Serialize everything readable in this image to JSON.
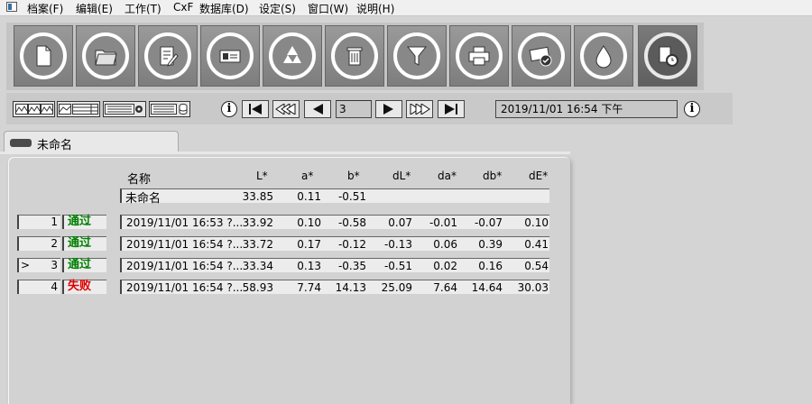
{
  "menu": [
    "档案(F)",
    "编辑(E)",
    "工作(T)",
    "CxF",
    "数据库(D)",
    "设定(S)",
    "窗口(W)",
    "说明(H)"
  ],
  "toolbar": [
    {
      "icon": "new-document-icon"
    },
    {
      "icon": "open-folder-icon"
    },
    {
      "icon": "edit-notes-icon"
    },
    {
      "icon": "card-icon"
    },
    {
      "icon": "recycle-icon"
    },
    {
      "icon": "trash-icon"
    },
    {
      "icon": "filter-icon"
    },
    {
      "icon": "print-icon"
    },
    {
      "icon": "verify-card-icon"
    },
    {
      "icon": "drop-icon"
    },
    {
      "icon": "timed-document-icon"
    }
  ],
  "nav": {
    "page": "3",
    "datetime": "2019/11/01 16:54 下午"
  },
  "tab": {
    "label": "未命名"
  },
  "table": {
    "headers": {
      "name": "名称",
      "L": "L*",
      "a": "a*",
      "b": "b*",
      "dL": "dL*",
      "da": "da*",
      "db": "db*",
      "dE": "dE*"
    },
    "standard": {
      "name": "未命名",
      "L": "33.85",
      "a": "0.11",
      "b": "-0.51"
    },
    "rows": [
      {
        "marker": "",
        "index": "1",
        "status": "通过",
        "pass": true,
        "name": "2019/11/01 16:53 ?...",
        "L": "33.92",
        "a": "0.10",
        "b": "-0.58",
        "dL": "0.07",
        "da": "-0.01",
        "db": "-0.07",
        "dE": "0.10"
      },
      {
        "marker": "",
        "index": "2",
        "status": "通过",
        "pass": true,
        "name": "2019/11/01 16:54 ?...",
        "L": "33.72",
        "a": "0.17",
        "b": "-0.12",
        "dL": "-0.13",
        "da": "0.06",
        "db": "0.39",
        "dE": "0.41"
      },
      {
        "marker": ">",
        "index": "3",
        "status": "通过",
        "pass": true,
        "name": "2019/11/01 16:54 ?...",
        "L": "33.34",
        "a": "0.13",
        "b": "-0.35",
        "dL": "-0.51",
        "da": "0.02",
        "db": "0.16",
        "dE": "0.54"
      },
      {
        "marker": "",
        "index": "4",
        "status": "失败",
        "pass": false,
        "name": "2019/11/01 16:54 ?...",
        "L": "58.93",
        "a": "7.74",
        "b": "14.13",
        "dL": "25.09",
        "da": "7.64",
        "db": "14.64",
        "dE": "30.03"
      }
    ]
  },
  "colors": {
    "pass": "#008000",
    "fail": "#e00000"
  }
}
